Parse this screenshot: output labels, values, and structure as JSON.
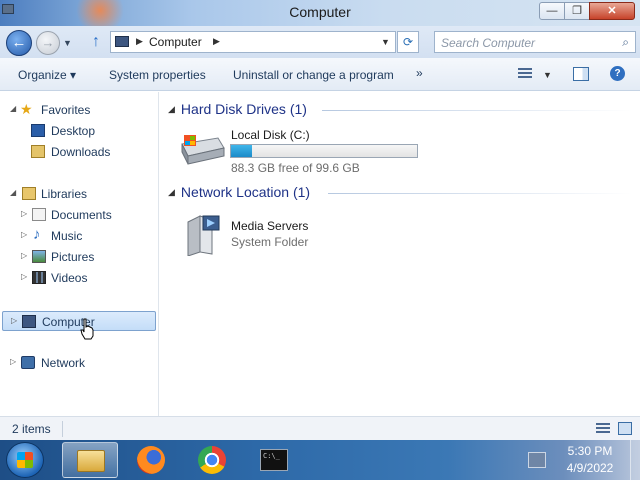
{
  "window": {
    "title": "Computer",
    "min_glyph": "—",
    "max_glyph": "❐",
    "close_glyph": "✕"
  },
  "address": {
    "back_glyph": "←",
    "forward_glyph": "→",
    "up_glyph": "↑",
    "crumb": "Computer",
    "refresh_glyph": "⟳",
    "search_placeholder": "Search Computer",
    "search_glyph": "⌕"
  },
  "toolbar": {
    "organize": "Organize ▾",
    "system_properties": "System properties",
    "uninstall": "Uninstall or change a program",
    "more": "»"
  },
  "nav": {
    "favorites": "Favorites",
    "desktop": "Desktop",
    "downloads": "Downloads",
    "libraries": "Libraries",
    "documents": "Documents",
    "music": "Music",
    "pictures": "Pictures",
    "videos": "Videos",
    "computer": "Computer",
    "network": "Network"
  },
  "content": {
    "hard_disk_header": "Hard Disk Drives (1)",
    "drive_name": "Local Disk (C:)",
    "drive_free": "88.3 GB free of 99.6 GB",
    "drive_used_fraction": 0.113,
    "network_header": "Network Location (1)",
    "media_name": "Media Servers",
    "media_type": "System Folder"
  },
  "status": {
    "items": "2 items"
  },
  "taskbar": {
    "cmd_text": "C:\\_",
    "time": "5:30 PM",
    "date": "4/9/2022"
  }
}
